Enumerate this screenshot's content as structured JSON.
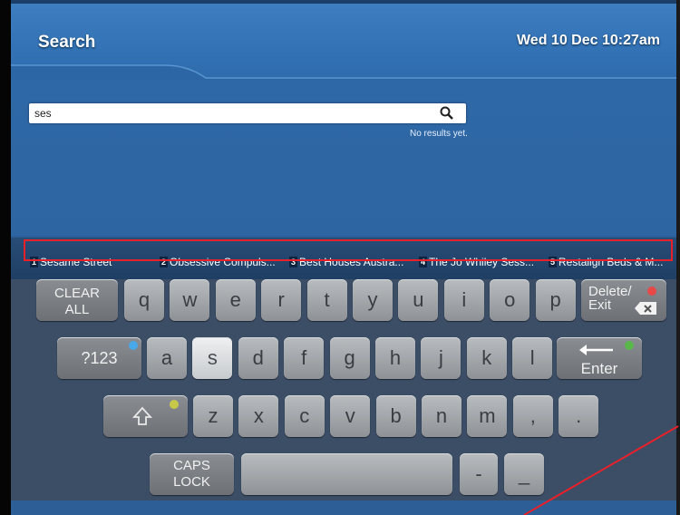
{
  "header": {
    "title": "Search",
    "datetime": "Wed 10 Dec 10:27am"
  },
  "search": {
    "value": "ses",
    "status": "No results yet."
  },
  "suggestions": [
    {
      "num": "1",
      "label": "Sesame Street"
    },
    {
      "num": "2",
      "label": "Obsessive Compuls..."
    },
    {
      "num": "3",
      "label": "Best Houses Austra..."
    },
    {
      "num": "4",
      "label": "The Jo Whiley Sess..."
    },
    {
      "num": "5",
      "label": "Restalign Beds & M..."
    }
  ],
  "keyboard": {
    "row1": [
      "q",
      "w",
      "e",
      "r",
      "t",
      "y",
      "u",
      "i",
      "o",
      "p"
    ],
    "row2": [
      "a",
      "s",
      "d",
      "f",
      "g",
      "h",
      "j",
      "k",
      "l"
    ],
    "row3": [
      "z",
      "x",
      "c",
      "v",
      "b",
      "n",
      "m",
      ",",
      "."
    ],
    "clear_all_line1": "CLEAR",
    "clear_all_line2": "ALL",
    "delete_line1": "Delete/",
    "delete_line2": "Exit",
    "symbols_label": "?123",
    "enter_label": "Enter",
    "caps_line1": "CAPS",
    "caps_line2": "LOCK",
    "dash_label": "-",
    "underscore_label": "_",
    "shift_icon": "up-arrow-icon",
    "backspace_icon": "backspace-icon",
    "enter_icon": "enter-arrow-icon"
  },
  "colors": {
    "dot_blue": "#48a8e8",
    "dot_yellow": "#c8c84a",
    "dot_green": "#5ab84a",
    "dot_red": "#e84848",
    "highlight": "#e8202a"
  }
}
